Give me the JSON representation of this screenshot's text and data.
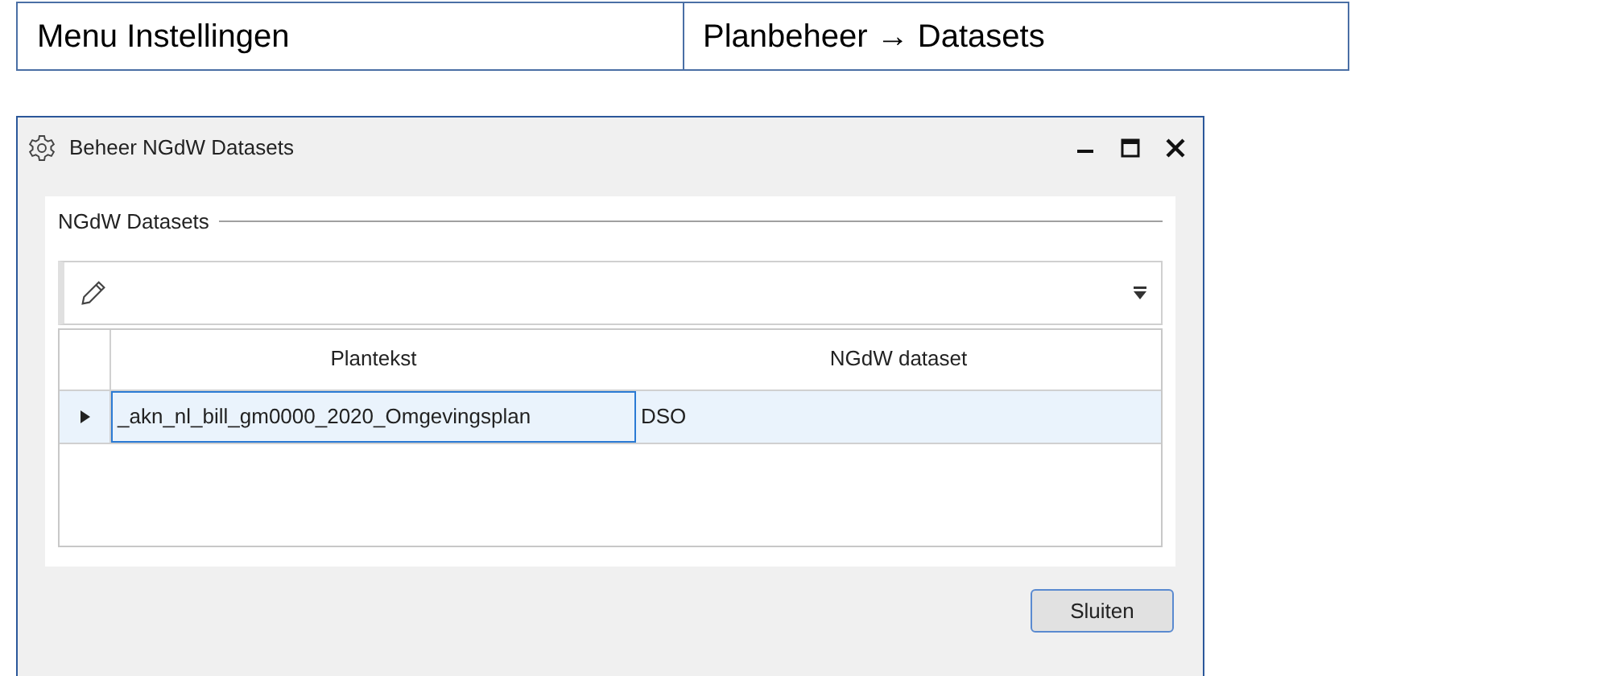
{
  "info_table": {
    "cells": [
      "Menu Instellingen",
      "Planbeheer → Datasets"
    ]
  },
  "window": {
    "title": "Beheer NGdW Datasets"
  },
  "group": {
    "title": "NGdW Datasets"
  },
  "grid": {
    "columns": [
      "Plantekst",
      "NGdW dataset"
    ],
    "rows": [
      {
        "selected": true,
        "cells": [
          "_akn_nl_bill_gm0000_2020_Omgevingsplan",
          "DSO"
        ]
      }
    ]
  },
  "buttons": [
    "Sluiten"
  ]
}
